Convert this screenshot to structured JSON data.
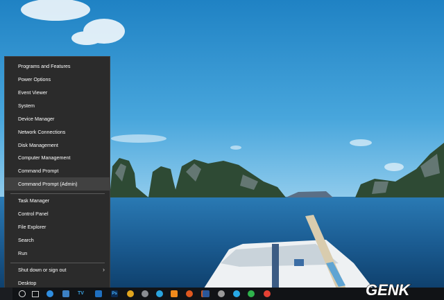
{
  "wallpaper": {
    "sky_color": "#3a9ad6",
    "sea_color": "#1d5f93"
  },
  "winx_menu": {
    "group1": [
      "Programs and Features",
      "Power Options",
      "Event Viewer",
      "System",
      "Device Manager",
      "Network Connections",
      "Disk Management",
      "Computer Management",
      "Command Prompt",
      "Command Prompt (Admin)"
    ],
    "group2": [
      "Task Manager",
      "Control Panel",
      "File Explorer",
      "Search",
      "Run"
    ],
    "group3": [
      "Shut down or sign out",
      "Desktop"
    ],
    "highlighted_item": "Command Prompt (Admin)",
    "submenu_item": "Shut down or sign out"
  },
  "taskbar": {
    "icons": [
      "cortana-icon",
      "task-view-icon",
      "edge-icon",
      "store-icon",
      "tv-icon",
      "mail-icon",
      "photoshop-icon",
      "chrome-canary-icon",
      "steam-icon",
      "telegram-icon",
      "vlc-icon",
      "firefox-icon",
      "app-icon",
      "word-icon",
      "settings-icon",
      "skype-icon",
      "hangouts-icon",
      "chrome-icon"
    ],
    "tv_label": "TV",
    "ps_label": "Ps"
  },
  "watermark": {
    "text": "GENK"
  }
}
